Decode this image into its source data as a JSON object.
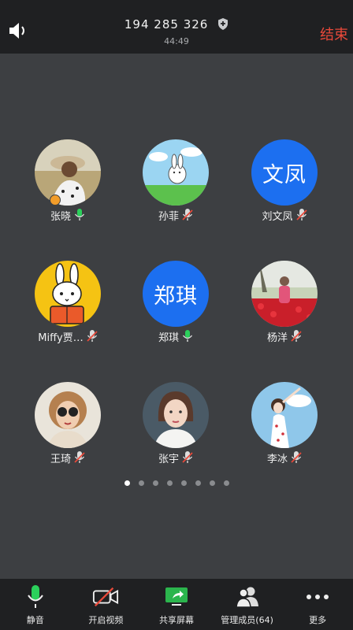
{
  "header": {
    "meeting_id": "194 285 326",
    "timer": "44:49",
    "end_label": "结束"
  },
  "participants": [
    {
      "name": "张晓",
      "avatar": "photo-woman-hat",
      "mic": "active",
      "host": true
    },
    {
      "name": "孙菲",
      "avatar": "rabbit-cartoon",
      "mic": "muted"
    },
    {
      "name": "刘文凤",
      "avatar_text": "文凤",
      "mic": "muted"
    },
    {
      "name": "Miffy贾…",
      "avatar": "miffy-cartoon",
      "mic": "muted"
    },
    {
      "name": "郑琪",
      "avatar_text": "郑琪",
      "mic": "active"
    },
    {
      "name": "杨洋",
      "avatar": "photo-flowers",
      "mic": "muted"
    },
    {
      "name": "王琦",
      "avatar": "photo-sunglasses",
      "mic": "muted"
    },
    {
      "name": "张宇",
      "avatar": "photo-girl",
      "mic": "muted"
    },
    {
      "name": "李冰",
      "avatar": "anime-girl-sky",
      "mic": "muted"
    }
  ],
  "pagination": {
    "count": 8,
    "active_index": 0
  },
  "toolbar": {
    "mute_label": "静音",
    "video_label": "开启视频",
    "share_label": "共享屏幕",
    "members_label": "管理成员(64)",
    "more_label": "更多"
  },
  "colors": {
    "accent_green": "#2bd05b",
    "end_red": "#e9493a",
    "brand_blue": "#1c6ff0"
  }
}
